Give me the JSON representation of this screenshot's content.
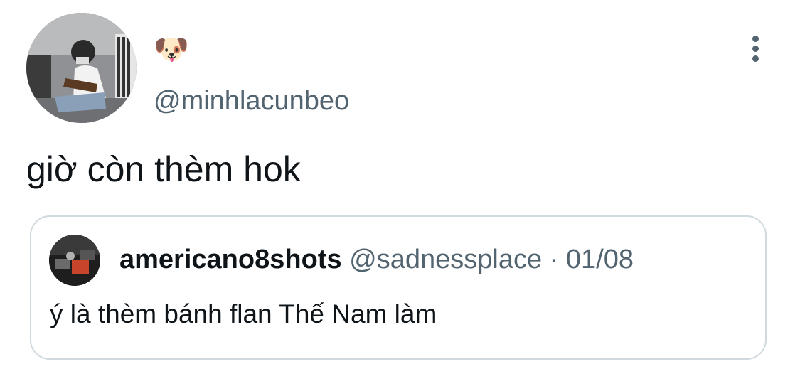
{
  "tweet": {
    "display_name": "🐶",
    "handle": "@minhlacunbeo",
    "text": "giờ còn thèm hok",
    "icons": {
      "avatar": "profile-photo",
      "more": "more-vertical-icon"
    }
  },
  "quote": {
    "name": "americano8shots",
    "handle": "@sadnessplace",
    "separator": "·",
    "date": "01/08",
    "text": "ý là thèm bánh flan Thế Nam làm"
  },
  "colors": {
    "text_primary": "#0f1419",
    "text_secondary": "#536471",
    "border": "#cfd9de"
  }
}
